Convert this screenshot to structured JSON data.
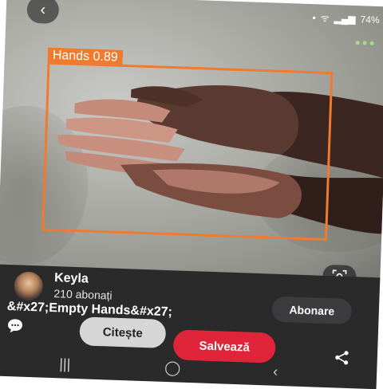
{
  "status": {
    "battery_text": "74%"
  },
  "detection": {
    "label": "Hands 0.89"
  },
  "channel": {
    "name": "Keyla",
    "subscribers": "210 abonați"
  },
  "post": {
    "title": "&#x27;Empty Hands&#x27;"
  },
  "buttons": {
    "subscribe": "Abonare",
    "read": "Citește",
    "save": "Salvează"
  },
  "colors": {
    "detection": "#f07a2e",
    "save": "#e02439",
    "sheet": "#2a2a2b"
  },
  "icons": [
    "back-arrow-icon",
    "more-icon",
    "lens-icon",
    "comment-icon",
    "share-icon",
    "recents-icon",
    "home-icon",
    "back-icon"
  ]
}
